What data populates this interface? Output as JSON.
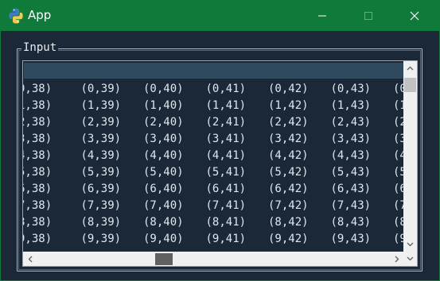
{
  "window": {
    "title": "App",
    "icon": "python-icon",
    "accent_color": "#0f7a3a",
    "controls": [
      "minimize-icon",
      "maximize-icon",
      "close-icon"
    ]
  },
  "frame": {
    "label": "Input"
  },
  "entry": {
    "value": ""
  },
  "grid": {
    "rows": [
      [
        "0,38)",
        "(0,39)",
        "(0,40)",
        "(0,41)",
        "(0,42)",
        "(0,43)",
        "(0"
      ],
      [
        "1,38)",
        "(1,39)",
        "(1,40)",
        "(1,41)",
        "(1,42)",
        "(1,43)",
        "(1"
      ],
      [
        "2,38)",
        "(2,39)",
        "(2,40)",
        "(2,41)",
        "(2,42)",
        "(2,43)",
        "(2"
      ],
      [
        "3,38)",
        "(3,39)",
        "(3,40)",
        "(3,41)",
        "(3,42)",
        "(3,43)",
        "(3"
      ],
      [
        "4,38)",
        "(4,39)",
        "(4,40)",
        "(4,41)",
        "(4,42)",
        "(4,43)",
        "(4"
      ],
      [
        "5,38)",
        "(5,39)",
        "(5,40)",
        "(5,41)",
        "(5,42)",
        "(5,43)",
        "(5"
      ],
      [
        "6,38)",
        "(6,39)",
        "(6,40)",
        "(6,41)",
        "(6,42)",
        "(6,43)",
        "(6"
      ],
      [
        "7,38)",
        "(7,39)",
        "(7,40)",
        "(7,41)",
        "(7,42)",
        "(7,43)",
        "(7"
      ],
      [
        "8,38)",
        "(8,39)",
        "(8,40)",
        "(8,41)",
        "(8,42)",
        "(8,43)",
        "(8"
      ],
      [
        "9,38)",
        "(9,39)",
        "(9,40)",
        "(9,41)",
        "(9,42)",
        "(9,43)",
        "(9"
      ]
    ]
  }
}
